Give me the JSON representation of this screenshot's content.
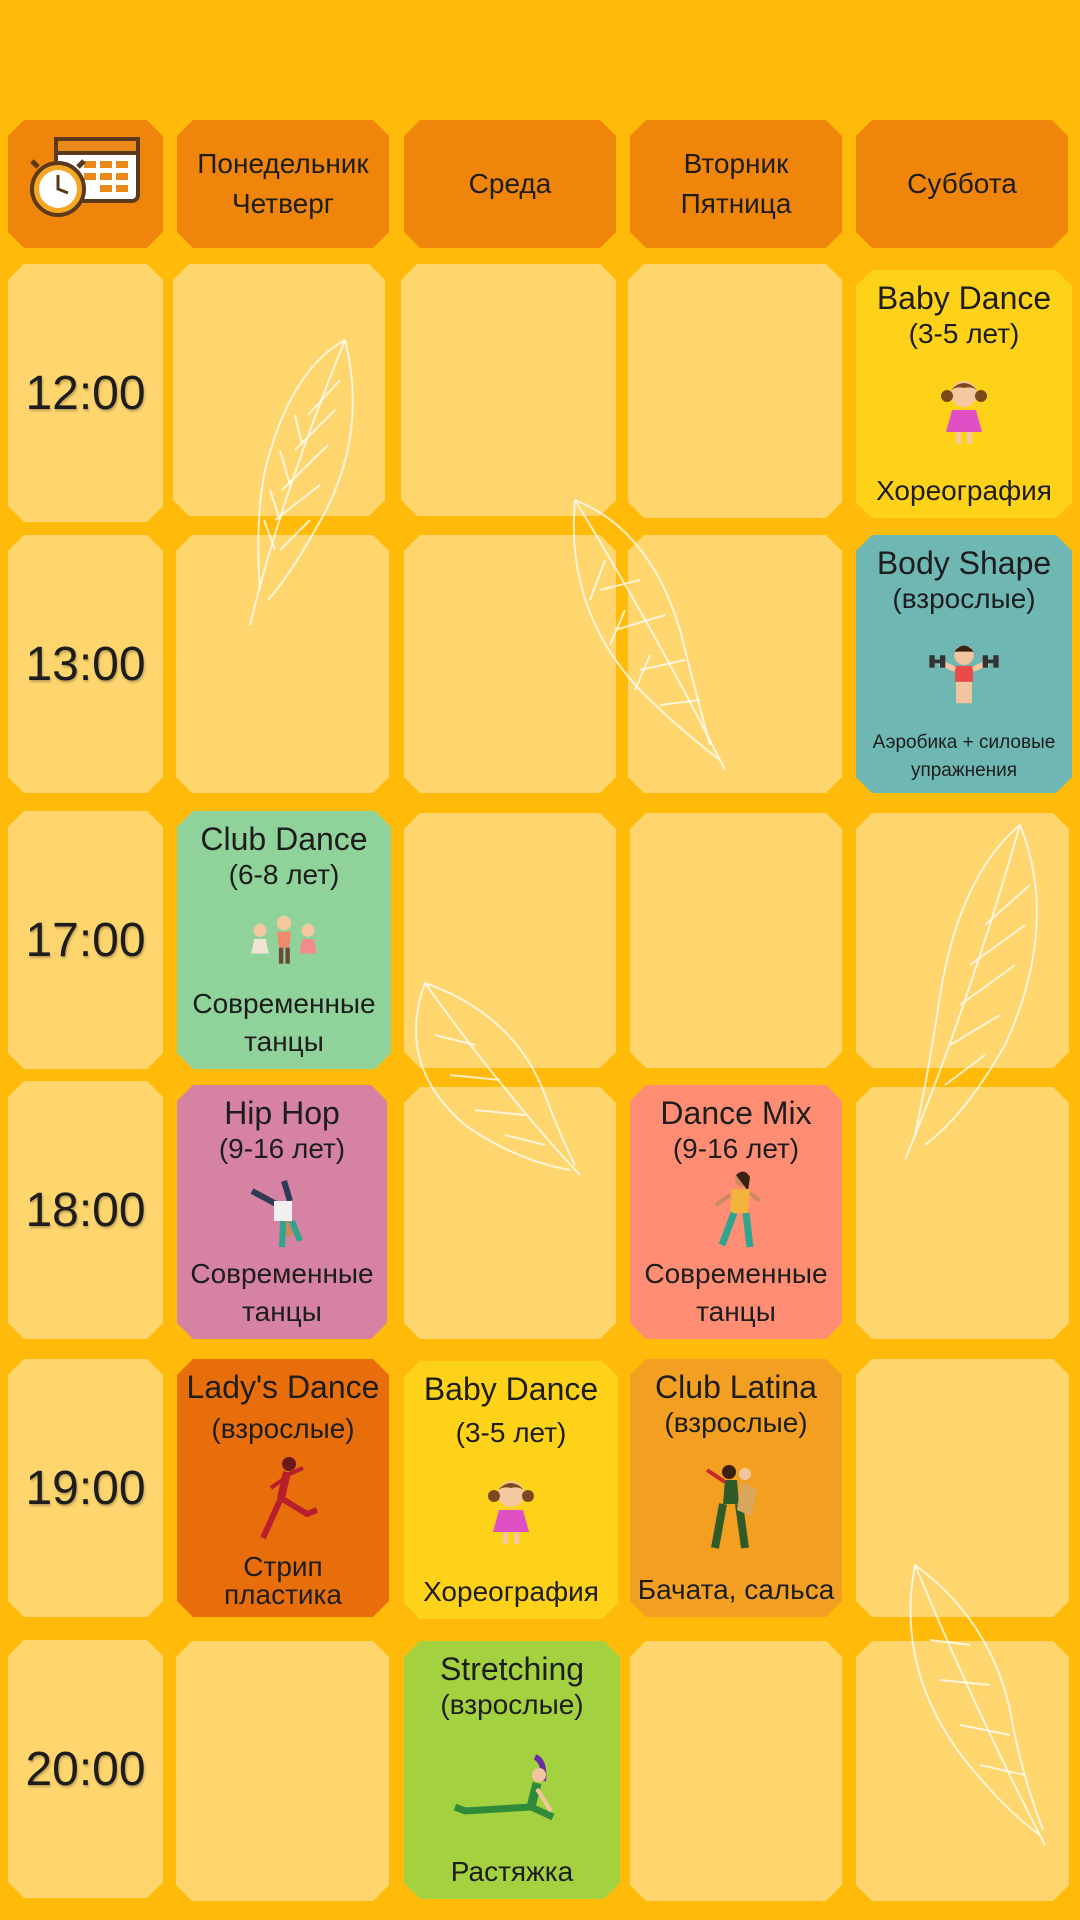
{
  "headers": {
    "calendar_icon": "calendar-clock-icon",
    "col1_line1": "Понедельник",
    "col1_line2": "Четверг",
    "col2": "Среда",
    "col3_line1": "Вторник",
    "col3_line2": "Пятница",
    "col4": "Суббота"
  },
  "times": [
    "12:00",
    "13:00",
    "17:00",
    "18:00",
    "19:00",
    "20:00"
  ],
  "classes": {
    "sat_1200": {
      "title": "Baby Dance",
      "age": "(3-5 лет)",
      "desc": "Хореография",
      "icon": "girl-icon",
      "color": "#FFD21A"
    },
    "sat_1300": {
      "title": "Body Shape",
      "age": "(взрослые)",
      "desc": "Аэробика + силовые упражнения",
      "icon": "woman-dumbbells-icon",
      "color": "#6FB7B3"
    },
    "mon_1700": {
      "title": "Club Dance",
      "age": "(6-8 лет)",
      "desc": "Современные танцы",
      "icon": "kids-dancing-icon",
      "color": "#8FD39B"
    },
    "mon_1800": {
      "title": "Hip Hop",
      "age": "(9-16 лет)",
      "desc": "Современные танцы",
      "icon": "breakdancer-icon",
      "color": "#D682A3"
    },
    "tue_1800": {
      "title": "Dance Mix",
      "age": "(9-16 лет)",
      "desc": "Современные танцы",
      "icon": "dancer-icon",
      "color": "#FF8D74"
    },
    "mon_1900": {
      "title": "Lady's Dance",
      "age": "(взрослые)",
      "desc": "Стрип пластика",
      "icon": "leaping-dancer-icon",
      "color": "#E86E0C"
    },
    "wed_1900": {
      "title": "Baby Dance",
      "age": "(3-5 лет)",
      "desc": "Хореография",
      "icon": "girl-icon",
      "color": "#FFD21A"
    },
    "tue_1900": {
      "title": "Club Latina",
      "age": "(взрослые)",
      "desc": "Бачата, сальса",
      "icon": "latin-dancers-icon",
      "color": "#F29F22"
    },
    "wed_2000": {
      "title": "Stretching",
      "age": "(взрослые)",
      "desc": "Растяжка",
      "icon": "stretching-woman-icon",
      "color": "#A3D140"
    }
  }
}
